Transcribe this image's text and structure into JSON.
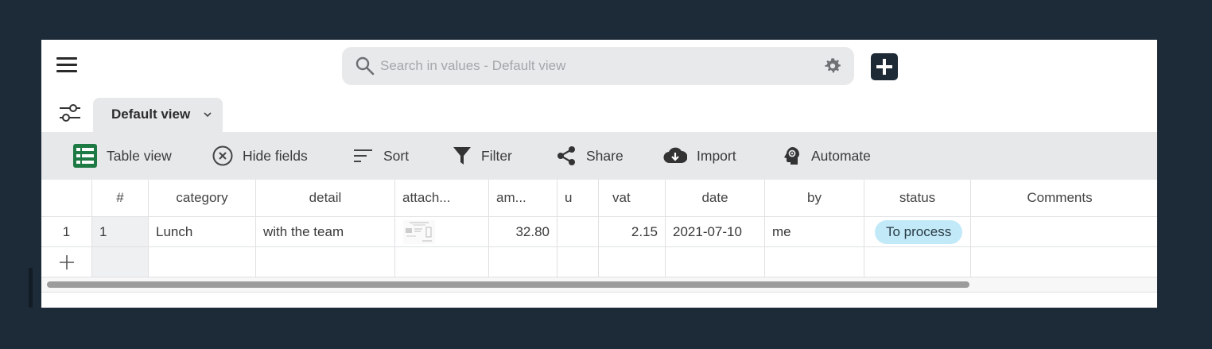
{
  "search": {
    "placeholder": "Search in values - Default view"
  },
  "view": {
    "active_label": "Default view"
  },
  "toolbar": [
    {
      "label": "Table view",
      "icon": "table-view-icon"
    },
    {
      "label": "Hide fields",
      "icon": "hide-fields-icon"
    },
    {
      "label": "Sort",
      "icon": "sort-icon"
    },
    {
      "label": "Filter",
      "icon": "filter-icon"
    },
    {
      "label": "Share",
      "icon": "share-icon"
    },
    {
      "label": "Import",
      "icon": "import-icon"
    },
    {
      "label": "Automate",
      "icon": "automate-icon"
    }
  ],
  "table": {
    "columns": [
      "#",
      "category",
      "detail",
      "attach...",
      "am...",
      "u",
      "vat",
      "date",
      "by",
      "status",
      "Comments"
    ],
    "rows": [
      {
        "row_number": "1",
        "id": "1",
        "category": "Lunch",
        "detail": "with the team",
        "amount": "32.80",
        "unit": "",
        "vat": "2.15",
        "date": "2021-07-10",
        "by": "me",
        "status": "To process",
        "comments": ""
      }
    ],
    "add_row_symbol": "+"
  },
  "colors": {
    "background": "#1d2b38",
    "toolbar": "#e6e8ea",
    "table_view_icon": "#1e7a44",
    "status_badge": "#c2e9f8"
  }
}
